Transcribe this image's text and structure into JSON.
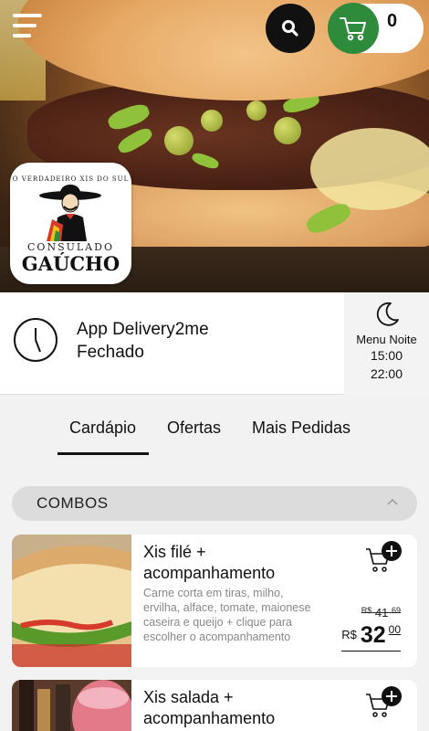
{
  "header": {
    "cart_count": "0"
  },
  "logo": {
    "arc_text": "O VERDADEIRO XIS DO SUL",
    "name_line1": "CONSULADO",
    "name_line2": "GAÚCHO"
  },
  "status": {
    "app_name": "App Delivery2me",
    "state": "Fechado",
    "schedule_label": "Menu Noite",
    "open_time": "15:00",
    "close_time": "22:00"
  },
  "tabs": [
    {
      "label": "Cardápio",
      "active": true
    },
    {
      "label": "Ofertas",
      "active": false
    },
    {
      "label": "Mais Pedidas",
      "active": false
    }
  ],
  "category": {
    "label": "COMBOS",
    "expanded": true
  },
  "products": [
    {
      "title": "Xis filé + acompanhamento",
      "description": "Carne corta em tiras, milho, ervilha, alface, tomate, maionese caseira e queijo + clique para escolher o acompanhamento",
      "old_price_currency": "R$",
      "old_price_int": "41",
      "old_price_cents": "69",
      "price_currency": "R$",
      "price_int": "32",
      "price_cents": "00"
    },
    {
      "title": "Xis salada + acompanhamento"
    }
  ],
  "colors": {
    "cart_green": "#2e8b3c",
    "search_black": "#111111",
    "background": "#f2f2f2"
  },
  "icons": {
    "menu": "hamburger-icon",
    "search": "search-icon",
    "cart": "cart-icon",
    "clock": "clock-icon",
    "moon": "moon-icon",
    "chevron": "chevron-up-icon",
    "add": "add-to-cart-icon"
  }
}
